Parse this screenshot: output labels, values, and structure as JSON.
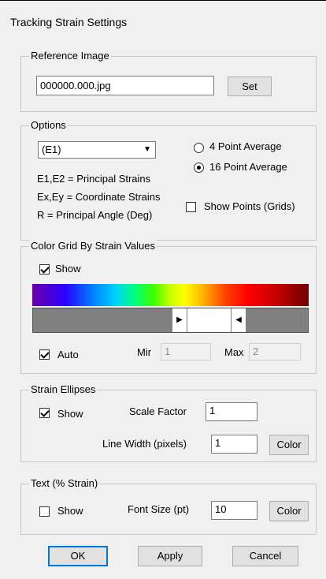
{
  "window": {
    "title": "Tracking Strain Settings"
  },
  "reference_image": {
    "group_label": "Reference Image",
    "filename": "000000.000.jpg",
    "set_label": "Set"
  },
  "options": {
    "group_label": "Options",
    "strain_select": "(E1)",
    "radio_4": "4 Point Average",
    "radio_16": "16 Point Average",
    "selected_average": "16 Point Average",
    "legend_line1": "E1,E2 = Principal Strains",
    "legend_line2": "Ex,Ey = Coordinate Strains",
    "legend_line3": "R = Principal Angle (Deg)",
    "show_points_label": "Show Points (Grids)",
    "show_points_checked": false
  },
  "color_grid": {
    "group_label": "Color Grid By Strain Values",
    "show_label": "Show",
    "show_checked": true,
    "auto_label": "Auto",
    "auto_checked": true,
    "min_label": "Mir",
    "min_value": "1",
    "max_label": "Max",
    "max_value": "2",
    "range_low_fraction": 0.46,
    "range_high_fraction": 0.68
  },
  "strain_ellipses": {
    "group_label": "Strain Ellipses",
    "show_label": "Show",
    "show_checked": true,
    "scale_label": "Scale Factor",
    "scale_value": "1",
    "linewidth_label": "Line Width (pixels)",
    "linewidth_value": "1",
    "color_label": "Color"
  },
  "text_strain": {
    "group_label": "Text (% Strain)",
    "show_label": "Show",
    "show_checked": false,
    "fontsize_label": "Font Size (pt)",
    "fontsize_value": "10",
    "color_label": "Color"
  },
  "buttons": {
    "ok": "OK",
    "apply": "Apply",
    "cancel": "Cancel"
  }
}
